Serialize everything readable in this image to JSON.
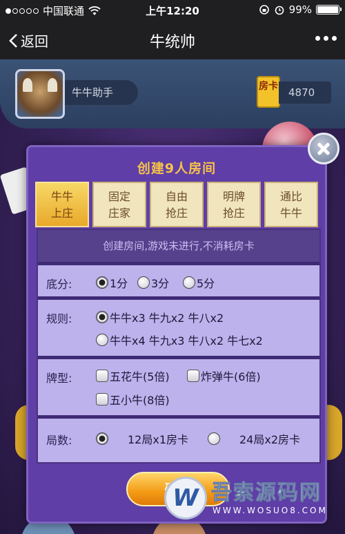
{
  "status": {
    "carrier": "中国联通",
    "time": "上午12:20",
    "battery": "99%"
  },
  "nav": {
    "back_label": "返回",
    "title": "牛统帅"
  },
  "player": {
    "nickname": "牛牛助手",
    "room_card_label": "房卡",
    "room_card_count": "4870"
  },
  "dialog": {
    "title": "创建9人房间",
    "tabs": [
      {
        "label_line1": "牛牛",
        "label_line2": "上庄",
        "selected": true
      },
      {
        "label_line1": "固定",
        "label_line2": "庄家",
        "selected": false
      },
      {
        "label_line1": "自由",
        "label_line2": "抢庄",
        "selected": false
      },
      {
        "label_line1": "明牌",
        "label_line2": "抢庄",
        "selected": false
      },
      {
        "label_line1": "通比",
        "label_line2": "牛牛",
        "selected": false
      }
    ],
    "notice": "创建房间,游戏未进行,不消耗房卡",
    "base_score": {
      "label": "底分:",
      "options": [
        "1分",
        "3分",
        "5分"
      ],
      "selected": "1分"
    },
    "rules": {
      "label": "规则:",
      "options": [
        "牛牛x3 牛九x2 牛八x2",
        "牛牛x4 牛九x3 牛八x2 牛七x2"
      ],
      "selected": "牛牛x3 牛九x2 牛八x2"
    },
    "card_types": {
      "label": "牌型:",
      "options": [
        "五花牛(5倍)",
        "炸弹牛(6倍)",
        "五小牛(8倍)"
      ]
    },
    "rounds": {
      "label": "局数:",
      "options": [
        "12局x1房卡",
        "24局x2房卡"
      ],
      "selected": "12局x1房卡"
    },
    "confirm_label": "确定"
  },
  "watermark": {
    "logo": "W",
    "title": "吾索源码网",
    "url": "WWW.WOSUO8.COM"
  }
}
